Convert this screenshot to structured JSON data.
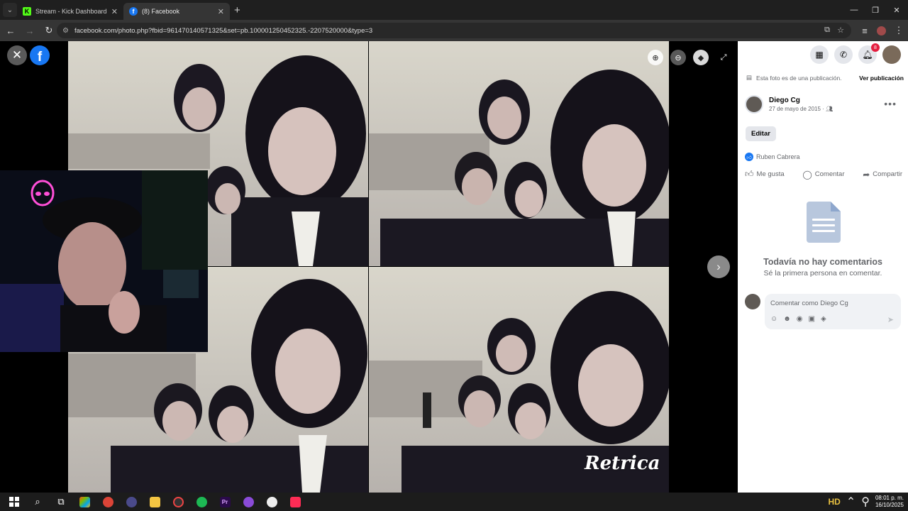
{
  "browser": {
    "tabs": [
      {
        "title": "Stream - Kick Dashboard",
        "favicon": "kick-icon",
        "active": false
      },
      {
        "title": "(8) Facebook",
        "favicon": "facebook-icon",
        "active": true
      }
    ],
    "new_tab_label": "+",
    "url": "facebook.com/photo.php?fbid=961470140571325&set=pb.100001250452325.-2207520000&type=3"
  },
  "viewer": {
    "close_icon": "close-icon",
    "watermark": "Retrica"
  },
  "panel": {
    "publication_note": "Esta foto es de una publicación.",
    "view_post_label": "Ver publicación",
    "notification_count": "8",
    "author_name": "Diego Cg",
    "post_date": "27 de mayo de 2015 ·",
    "edit_label": "Editar",
    "reactor_name": "Ruben Cabrera",
    "actions": {
      "like": "Me gusta",
      "comment": "Comentar",
      "share": "Compartir"
    },
    "empty_title": "Todavía no hay comentarios",
    "empty_subtitle": "Sé la primera persona en comentar.",
    "comment_placeholder": "Comentar como Diego Cg"
  },
  "taskbar": {
    "time": "08:01 p. m.",
    "date": "16/10/2025"
  },
  "colors": {
    "facebook_blue": "#1877f2",
    "badge_red": "#e41e3f",
    "kick_green": "#53fc18"
  }
}
